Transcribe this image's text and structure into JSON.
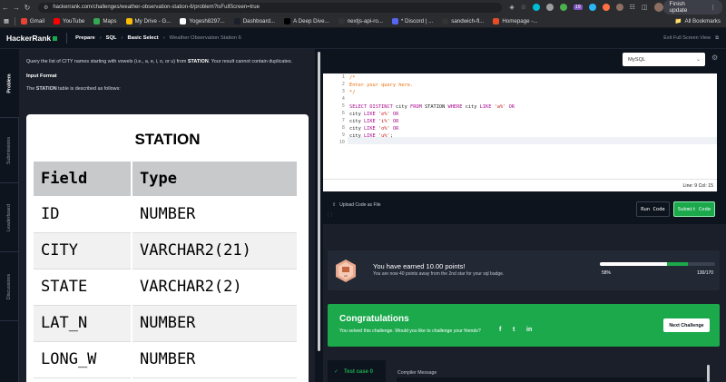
{
  "browser": {
    "url": "hackerrank.com/challenges/weather-observation-station-6/problem?isFullScreen=true",
    "finish_update": "Finish update",
    "ext_badge": "19",
    "bookmarks": [
      {
        "label": "Gmail",
        "color": "#ea4335"
      },
      {
        "label": "YouTube",
        "color": "#ff0000"
      },
      {
        "label": "Maps",
        "color": "#34a853"
      },
      {
        "label": "My Drive - G...",
        "color": "#fbbc04"
      },
      {
        "label": "Yogesh8297...",
        "color": "#ffffff"
      },
      {
        "label": "Dashboard...",
        "color": "#1a1f29"
      },
      {
        "label": "A Deep Dive...",
        "color": "#000000"
      },
      {
        "label": "nextjs-api-ro...",
        "color": "#333333"
      },
      {
        "label": "* Discord | ...",
        "color": "#5865f2"
      },
      {
        "label": "sandwich-fl...",
        "color": "#333333"
      },
      {
        "label": "Homepage -...",
        "color": "#e44d26"
      }
    ],
    "all_bookmarks": "All Bookmarks"
  },
  "header": {
    "logo": "HackerRank",
    "crumbs": [
      "Prepare",
      "SQL",
      "Basic Select"
    ],
    "current": "Weather Observation Station 6",
    "exit_fullscreen": "Exit Full Screen View"
  },
  "side_tabs": [
    "Problem",
    "Submissions",
    "Leaderboard",
    "Discussions"
  ],
  "problem": {
    "intro_pre": "Query the list of CITY names starting with vowels (i.e., a, e, i, o, or u) from ",
    "intro_table": "STATION",
    "intro_post": ". Your result cannot contain duplicates.",
    "input_format": "Input Format",
    "desc_pre": "The ",
    "desc_table": "STATION",
    "desc_post": " table is described as follows:",
    "table_title": "STATION",
    "columns": [
      "Field",
      "Type"
    ],
    "rows": [
      [
        "ID",
        "NUMBER"
      ],
      [
        "CITY",
        "VARCHAR2(21)"
      ],
      [
        "STATE",
        "VARCHAR2(2)"
      ],
      [
        "LAT_N",
        "NUMBER"
      ],
      [
        "LONG_W",
        "NUMBER"
      ]
    ]
  },
  "editor": {
    "language": "MySQL",
    "line_numbers": [
      "1",
      "2",
      "3",
      "4",
      "5",
      "6",
      "7",
      "8",
      "9",
      "10"
    ],
    "comment_open": "/*",
    "comment_text": "Enter your query here.",
    "comment_close": "*/",
    "kw_select": "SELECT DISTINCT",
    "ident_city": "city",
    "kw_from": "FROM",
    "ident_station": "STATION",
    "kw_where": "WHERE",
    "kw_like": "LIKE",
    "kw_or": "OR",
    "patterns": [
      "'a%'",
      "'e%'",
      "'i%'",
      "'o%'",
      "'u%'"
    ],
    "terminator": ";",
    "status": "Line: 9 Col: 15"
  },
  "actions": {
    "upload": "Upload Code as File",
    "run": "Run Code",
    "submit": "Submit Code"
  },
  "result": {
    "badge_text": "sql",
    "points_title": "You have earned 10.00 points!",
    "points_sub": "You are now 40 points away from the 2nd star for your sql badge.",
    "progress_percent": "58%",
    "progress_value": 58,
    "progress_of": "130/170",
    "congrats_title": "Congratulations",
    "congrats_sub": "You solved this challenge. Would you like to challenge your friends?",
    "social": [
      "f",
      "t",
      "in"
    ],
    "next_button": "Next Challenge",
    "test_case": "Test case 0",
    "compiler_message": "Compiler Message"
  },
  "colors": {
    "brand_green": "#1ba94c",
    "dark_bg": "#0e141e",
    "panel_bg": "#1a1f29"
  }
}
